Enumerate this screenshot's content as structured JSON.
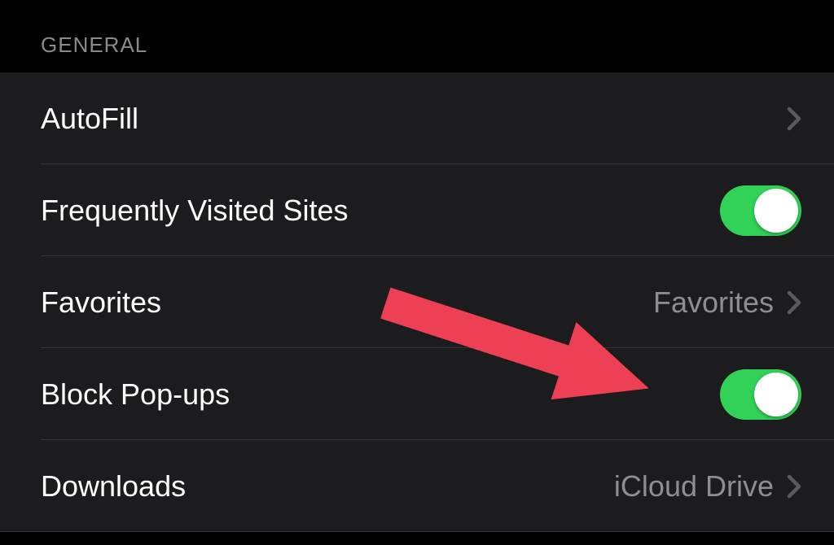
{
  "section": {
    "header": "GENERAL"
  },
  "rows": {
    "autofill": {
      "label": "AutoFill",
      "type": "nav"
    },
    "frequently_visited": {
      "label": "Frequently Visited Sites",
      "type": "toggle",
      "state": "on"
    },
    "favorites": {
      "label": "Favorites",
      "type": "nav",
      "value": "Favorites"
    },
    "block_popups": {
      "label": "Block Pop-ups",
      "type": "toggle",
      "state": "on"
    },
    "downloads": {
      "label": "Downloads",
      "type": "nav",
      "value": "iCloud Drive"
    }
  },
  "colors": {
    "toggle_on": "#32d158",
    "background": "#000000",
    "row_bg": "#1c1c1e",
    "text_primary": "#ffffff",
    "text_secondary": "#8d8d92",
    "annotation_arrow": "#ee4055"
  },
  "annotation": {
    "type": "arrow",
    "points_to": "block_popups_toggle"
  }
}
